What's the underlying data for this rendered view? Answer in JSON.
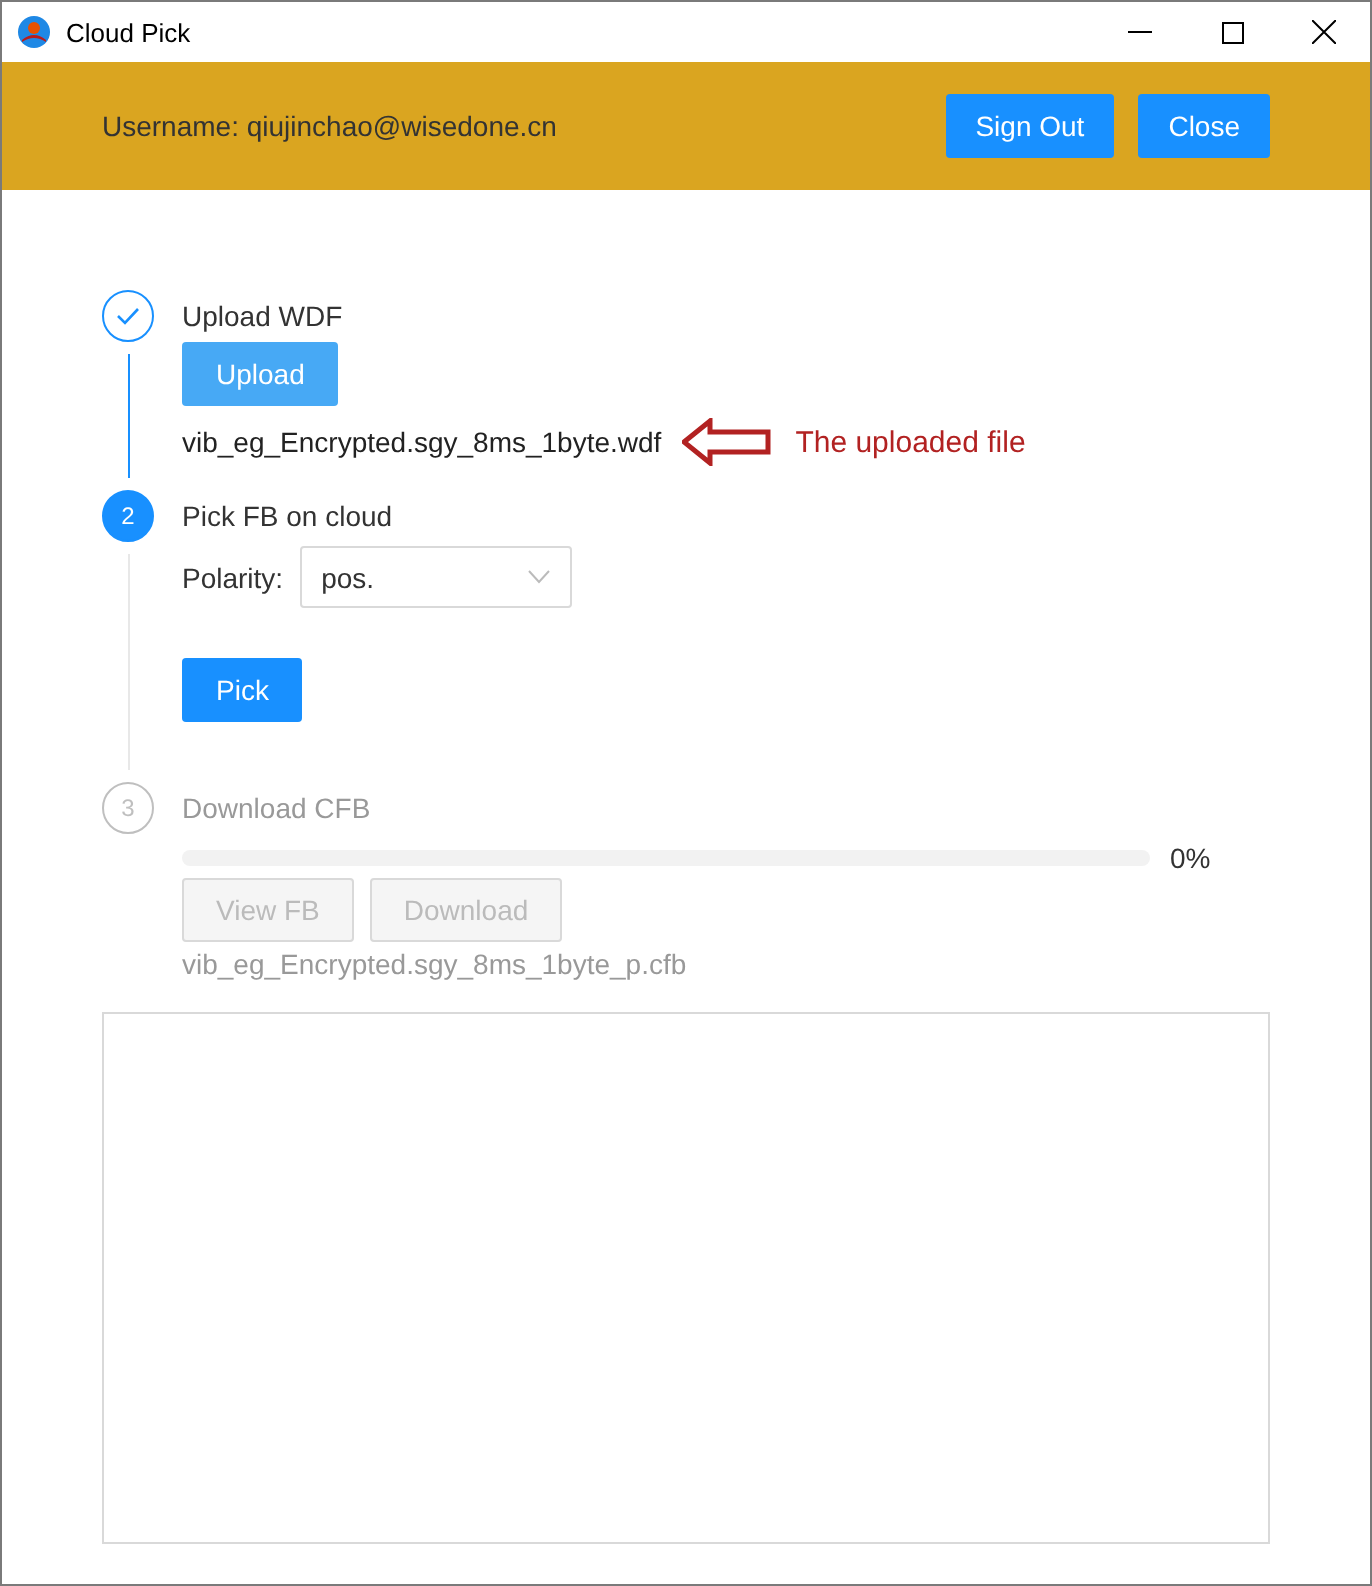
{
  "window": {
    "title": "Cloud Pick"
  },
  "header": {
    "username": "Username: qiujinchao@wisedone.cn",
    "buttons": [
      "Sign Out",
      "Close"
    ]
  },
  "steps": [
    {
      "kind": "upload",
      "completed": true,
      "current": false,
      "title": "Upload WDF",
      "button": "Upload",
      "file": "vib_eg_Encrypted.sgy_8ms_1byte.wdf",
      "annotation": "The uploaded file"
    },
    {
      "kind": "pick",
      "completed": false,
      "current": true,
      "number": "2",
      "title": "Pick FB on cloud",
      "polarity_label": "Polarity:",
      "polarity_value": "pos.",
      "button": "Pick"
    },
    {
      "kind": "download",
      "completed": false,
      "current": false,
      "number": "3",
      "title": "Download CFB",
      "level": 0,
      "reading": "0%",
      "buttons": [
        {
          "label": "View FB",
          "disabled": true
        },
        {
          "label": "Download",
          "disabled": true
        }
      ],
      "file": "vib_eg_Encrypted.sgy_8ms_1byte_p.cfb"
    }
  ],
  "log": {
    "kind": "empty"
  }
}
